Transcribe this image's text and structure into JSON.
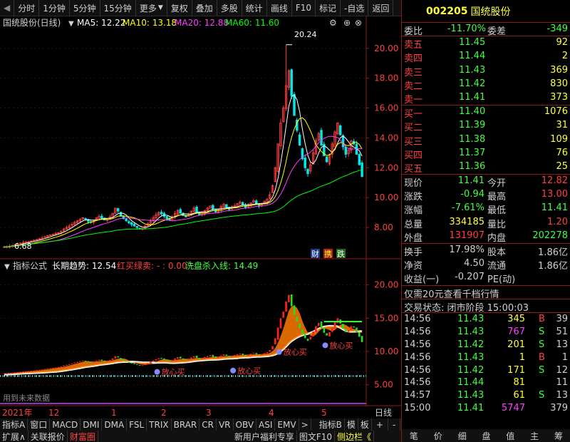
{
  "toolbar": {
    "items": [
      "分时",
      "1分钟",
      "5分钟",
      "15分钟",
      "更多",
      "复权",
      "叠加",
      "多股",
      "统计",
      "画线",
      "F10",
      "标记",
      "-自选",
      "返回"
    ]
  },
  "stock": {
    "code": "002205",
    "name": "国统股份"
  },
  "main_chart": {
    "title": "国统股份(日线)",
    "ma5_label": "MA5: 12.22",
    "ma10_label": "MA10: 13.18",
    "ma20_label": "MA20: 12.88",
    "ma60_label": "MA60: 11.60",
    "high_label": "20.24",
    "low_label": "6.68",
    "badges": [
      "财",
      "携",
      "跌"
    ]
  },
  "indicator": {
    "title": "指标公式",
    "trend_label": "长期趋势: 12.54",
    "red_buy_label": "红买绿卖: - : 0.00",
    "washout_label": "洗盘杀入线: 14.49",
    "future_note": "用到未来数据",
    "buy_labels": [
      "放心买",
      "放心买",
      "放心买",
      "放心买"
    ]
  },
  "time_axis": [
    "2021年",
    "12",
    "1",
    "2",
    "3",
    "4",
    "5"
  ],
  "bottom_bar": {
    "row1": [
      "指标A",
      "窗口",
      "MACD",
      "DMI",
      "DMA",
      "FSL",
      "TRIX",
      "BRAR",
      "CR",
      "VR",
      "OBV",
      "ASI",
      "EMV",
      ">",
      "指标B",
      "模",
      "板",
      "+",
      "-",
      "日线"
    ],
    "row2": [
      "扩展∧",
      "关联报价",
      "财富圈",
      "新用户福利专享",
      "图文F10",
      "侧边栏《"
    ]
  },
  "colors": {
    "up": "#ff4040",
    "down": "#00e8e8",
    "ma5": "#ffffff",
    "ma10": "#ffff00",
    "ma20": "#ff40ff",
    "ma60": "#00ff00",
    "green_text": "#40ff40",
    "red_text": "#ff4040",
    "yellow_text": "#ffff40"
  },
  "quote": {
    "wb_label": "委比",
    "wb_val": "-11.70%",
    "wc_label": "委差",
    "wc_val": "-349",
    "asks": [
      {
        "label": "卖五",
        "price": "11.45",
        "vol": "92"
      },
      {
        "label": "卖四",
        "price": "11.44",
        "vol": "2"
      },
      {
        "label": "卖三",
        "price": "11.43",
        "vol": "369"
      },
      {
        "label": "卖二",
        "price": "11.42",
        "vol": "830"
      },
      {
        "label": "卖一",
        "price": "11.41",
        "vol": "373"
      }
    ],
    "bids": [
      {
        "label": "买一",
        "price": "11.40",
        "vol": "1076"
      },
      {
        "label": "买二",
        "price": "11.39",
        "vol": "31"
      },
      {
        "label": "买三",
        "price": "11.38",
        "vol": "109"
      },
      {
        "label": "买四",
        "price": "11.37",
        "vol": "76"
      },
      {
        "label": "买五",
        "price": "11.36",
        "vol": "25"
      }
    ],
    "stats": [
      {
        "l1": "现价",
        "v1": "11.41",
        "l2": "今开",
        "v2": "12.82"
      },
      {
        "l1": "涨跌",
        "v1": "-0.94",
        "l2": "最高",
        "v2": "13.00"
      },
      {
        "l1": "涨幅",
        "v1": "-7.61%",
        "l2": "最低",
        "v2": "11.41"
      },
      {
        "l1": "总量",
        "v1": "334185",
        "l2": "量比",
        "v2": "1.20"
      },
      {
        "l1": "外盘",
        "v1": "131907",
        "l2": "内盘",
        "v2": "202278"
      }
    ],
    "stats2": [
      {
        "l1": "换手",
        "v1": "17.98%",
        "l2": "股本",
        "v2": "1.86亿"
      },
      {
        "l1": "净资",
        "v1": "4.50",
        "l2": "流通",
        "v2": "1.86亿"
      },
      {
        "l1": "收益(一)",
        "v1": "-0.207",
        "l2": "PE(动)",
        "v2": ""
      }
    ],
    "promo": "仅需20元查看千档行情",
    "trade_status": "交易状态: 闭市阶段 15:00:03",
    "ticks": [
      {
        "t": "14:56",
        "p": "11.43",
        "v": "345",
        "s": "B",
        "n": "39"
      },
      {
        "t": "14:56",
        "p": "11.43",
        "v": "767",
        "s": "S",
        "n": "51"
      },
      {
        "t": "14:56",
        "p": "11.42",
        "v": "201",
        "s": "S",
        "n": "13"
      },
      {
        "t": "14:56",
        "p": "11.43",
        "v": "1",
        "s": "B",
        "n": "1"
      },
      {
        "t": "14:56",
        "p": "11.42",
        "v": "171",
        "s": "S",
        "n": "12"
      },
      {
        "t": "14:56",
        "p": "11.44",
        "v": "81",
        "s": "",
        "n": "11"
      },
      {
        "t": "14:57",
        "p": "11.43",
        "v": "61",
        "s": "S",
        "n": "13"
      },
      {
        "t": "15:00",
        "p": "11.41",
        "v": "5747",
        "s": "",
        "n": "379"
      }
    ],
    "side_icons": [
      "笔",
      "价",
      "细",
      "盘",
      "值",
      "主",
      "筹"
    ]
  },
  "chart_data": {
    "type": "candlestick",
    "main_axis": {
      "ylim": [
        6.0,
        20.8
      ],
      "ticks": [
        "20.00",
        "18.00",
        "16.00",
        "14.00",
        "12.00",
        "10.00",
        "8.00"
      ]
    },
    "indicator_axis": {
      "ylim": [
        2.5,
        22.0
      ],
      "ticks": [
        "20.00",
        "15.00",
        "10.00",
        "5.00"
      ]
    },
    "close": [
      6.7,
      6.72,
      6.75,
      6.8,
      6.85,
      6.9,
      6.95,
      7.0,
      7.02,
      7.05,
      7.1,
      7.15,
      7.2,
      7.25,
      7.3,
      7.38,
      7.45,
      7.5,
      7.55,
      7.6,
      7.65,
      7.75,
      7.9,
      8.0,
      8.1,
      8.2,
      8.35,
      8.45,
      8.55,
      8.65,
      8.55,
      8.4,
      8.35,
      8.5,
      8.65,
      8.75,
      8.6,
      8.5,
      8.55,
      8.7,
      8.95,
      9.3,
      9.1,
      8.75,
      8.6,
      8.45,
      8.3,
      8.2,
      8.1,
      8.0,
      7.9,
      7.95,
      8.1,
      8.25,
      8.45,
      8.65,
      8.85,
      9.0,
      8.9,
      8.75,
      8.6,
      8.5,
      8.7,
      8.95,
      9.15,
      8.95,
      8.8,
      8.7,
      8.9,
      9.1,
      9.3,
      9.0,
      8.85,
      8.95,
      9.15,
      9.3,
      9.45,
      9.2,
      9.05,
      9.2,
      9.4,
      9.55,
      9.35,
      9.2,
      9.3,
      9.45,
      9.6,
      9.7,
      9.5,
      9.35,
      9.5,
      9.65,
      9.8,
      9.6,
      9.45,
      9.55,
      9.75,
      9.9,
      10.2,
      10.8,
      12.0,
      13.6,
      15.0,
      16.0,
      17.5,
      18.5,
      16.8,
      15.5,
      14.5,
      13.5,
      12.6,
      12.0,
      11.6,
      12.2,
      13.0,
      13.8,
      14.3,
      13.5,
      12.8,
      12.4,
      12.9,
      13.6,
      14.4,
      15.0,
      14.2,
      13.4,
      12.9,
      13.2,
      13.8,
      13.6,
      12.9,
      12.2,
      11.41
    ],
    "ma_values": {
      "ma5": 12.22,
      "ma10": 13.18,
      "ma20": 12.88,
      "ma60": 11.6
    },
    "indicator": {
      "long_trend": 12.54,
      "red_buy_green_sell": 0.0,
      "washout_line": 14.49
    }
  }
}
